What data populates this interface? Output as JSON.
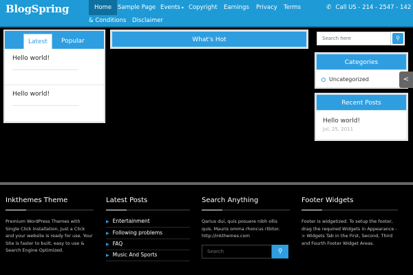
{
  "site": {
    "logo": "BlogSpring"
  },
  "nav": {
    "items": [
      {
        "label": "Home"
      },
      {
        "label": "Sample Page"
      },
      {
        "label": "Events"
      },
      {
        "label": "Copyright"
      },
      {
        "label": "Earnings"
      },
      {
        "label": "Privacy"
      },
      {
        "label": "Terms"
      },
      {
        "label": "& Conditions"
      },
      {
        "label": "Disclaimer"
      }
    ],
    "events_caret": "▾",
    "phone": "Call US - 214 - 2547 - 142"
  },
  "tabs": {
    "latest": "Latest",
    "popular": "Popular",
    "posts": [
      {
        "title": "Hello world!"
      },
      {
        "title": "Hello world!"
      }
    ]
  },
  "whats_hot": {
    "title": "What's Hot"
  },
  "sidebar": {
    "search_placeholder": "Search here",
    "categories_title": "Categories",
    "categories": [
      "Uncategorized"
    ],
    "recent_title": "Recent Posts",
    "recent_post": {
      "title": "Hello world!",
      "date": "Jul, 25, 2011"
    }
  },
  "footer": {
    "col1": {
      "title": "Inkthemes Theme",
      "text": "Premium WordPress Themes with Single Click Installation, Just a Click and your website is ready for use. Your Site is faster to built, easy to use & Search Engine Optimized."
    },
    "col2": {
      "title": "Latest Posts",
      "links": [
        "Entertainment",
        "Following problems",
        "FAQ",
        "Music And Sports"
      ]
    },
    "col3": {
      "title": "Search Anything",
      "text": "Qarius dui, quis posuere nibh ollis quis. Mauris omma rhoncus rtbitor. http://inkthemes.com",
      "search_placeholder": "Search"
    },
    "col4": {
      "title": "Footer Widgets",
      "text": "Footer is widgetized. To setup the footer, drag the required Widgets in Appearance -> Widgets Tab in the First, Second, Third and Fourth Footer Widget Areas."
    }
  },
  "colors": {
    "accent": "#2f9ee0",
    "topbar": "#1e9ad6",
    "active_nav": "#0f6f9f"
  }
}
